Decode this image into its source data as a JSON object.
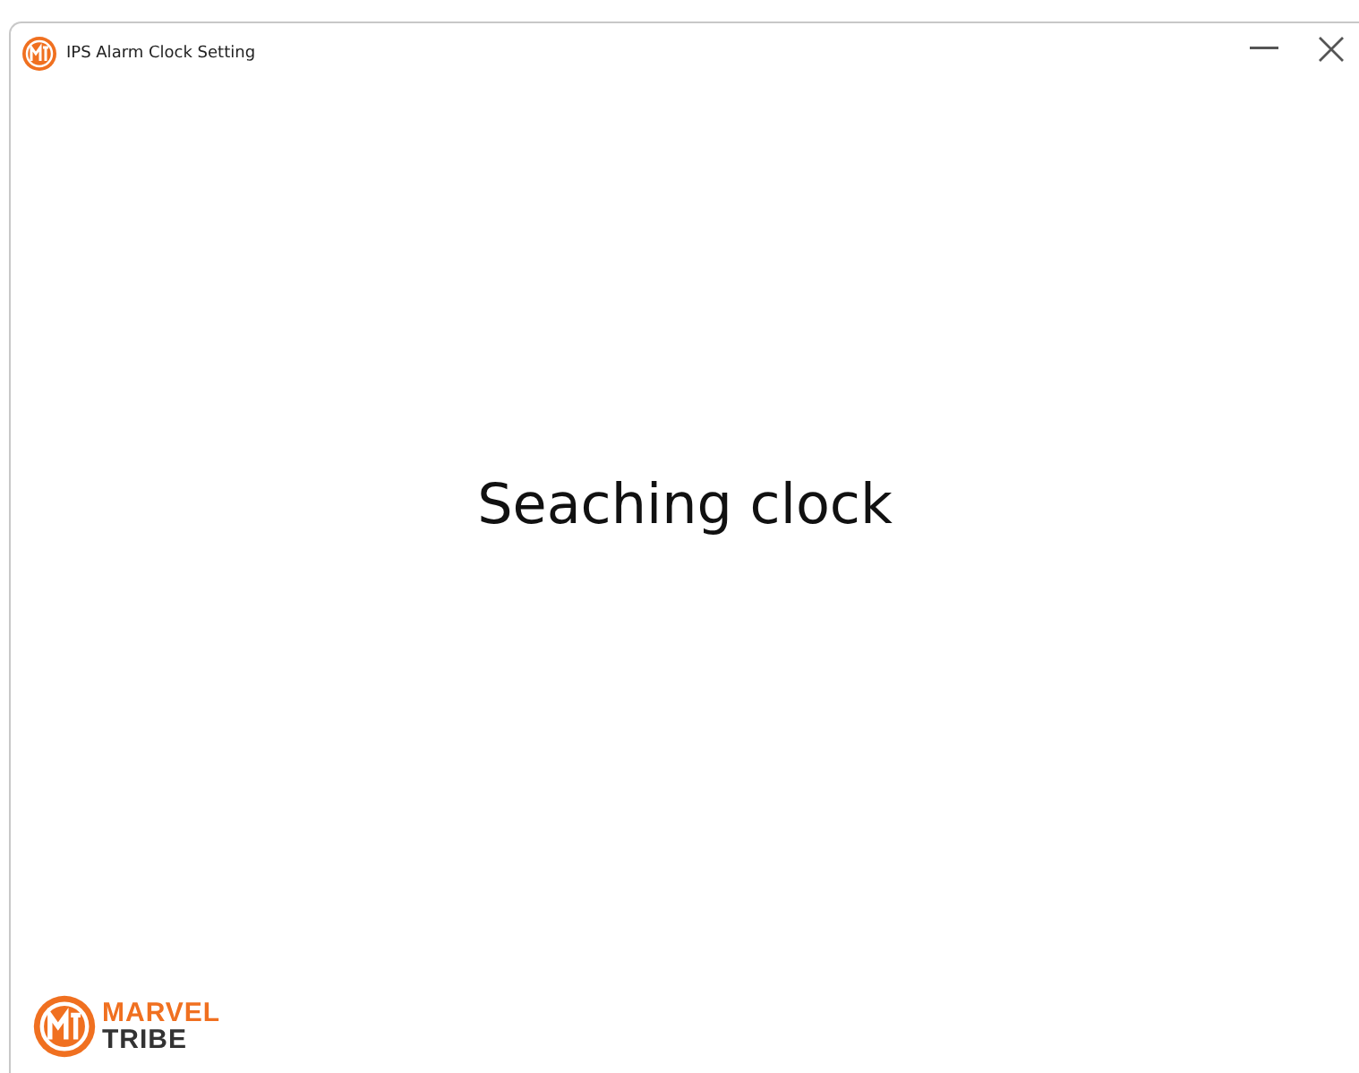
{
  "window": {
    "title": "IPS Alarm Clock Setting"
  },
  "status": {
    "message": "Seaching clock"
  },
  "brand": {
    "line_1": "MARVEL",
    "line_2": "TRIBE"
  }
}
